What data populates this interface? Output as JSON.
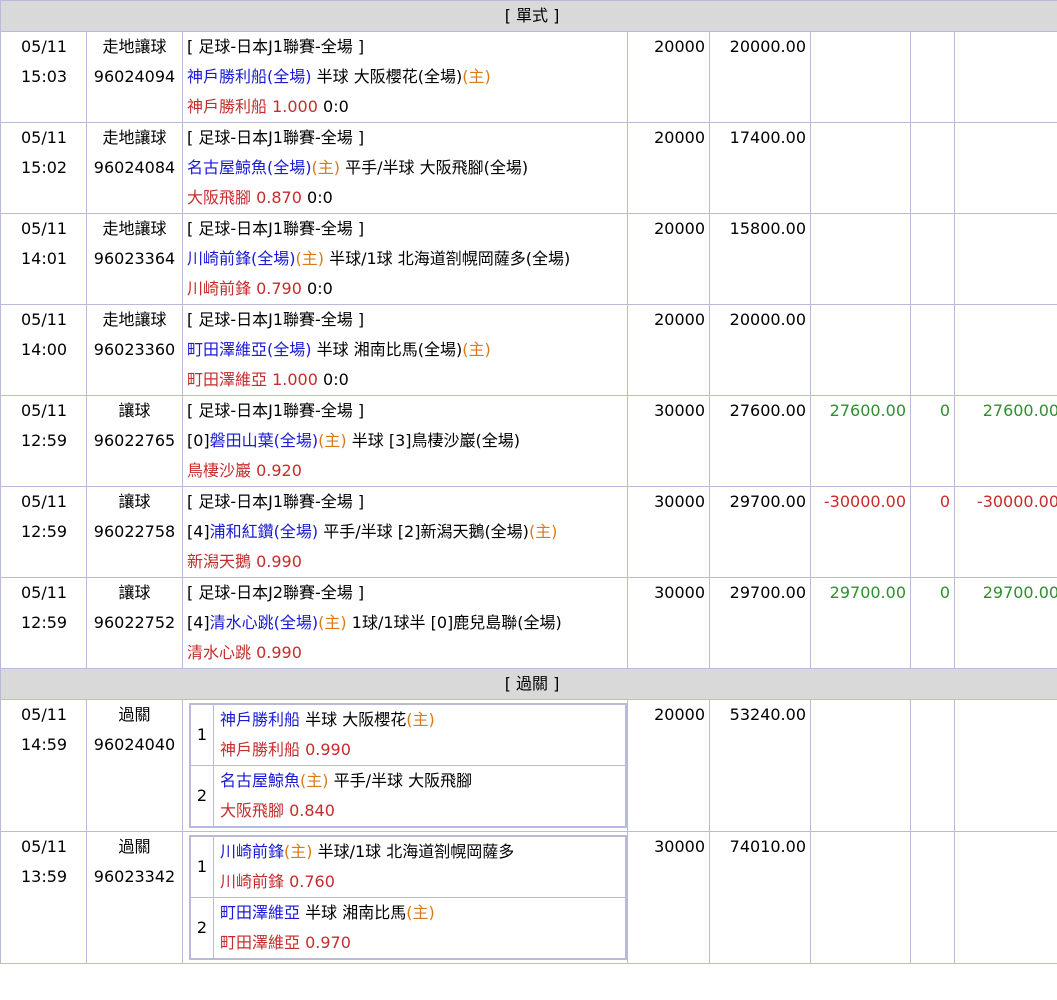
{
  "sections": {
    "single": "[ 單式 ]",
    "parlay": "[ 過關 ]"
  },
  "singles": [
    {
      "date": "05/11",
      "time": "15:03",
      "type": "走地讓球",
      "id": "96024094",
      "league": "[ 足球-日本J1聯賽-全場 ]",
      "home_prefix": "",
      "home": "神戶勝利船(全場)",
      "home_tag": "",
      "handicap": "半球",
      "away_prefix": "",
      "away": "大阪櫻花(全場)",
      "away_tag": "(主)",
      "pick": "神戶勝利船",
      "odds": "1.000",
      "score": "0:0",
      "stake": "20000",
      "payout": "20000.00",
      "result": "",
      "col2": "",
      "col3": ""
    },
    {
      "date": "05/11",
      "time": "15:02",
      "type": "走地讓球",
      "id": "96024084",
      "league": "[ 足球-日本J1聯賽-全場 ]",
      "home_prefix": "",
      "home": "名古屋鯨魚(全場)",
      "home_tag": "(主)",
      "handicap": "平手/半球",
      "away_prefix": "",
      "away": "大阪飛腳(全場)",
      "away_tag": "",
      "pick": "大阪飛腳",
      "odds": "0.870",
      "score": "0:0",
      "stake": "20000",
      "payout": "17400.00",
      "result": "",
      "col2": "",
      "col3": ""
    },
    {
      "date": "05/11",
      "time": "14:01",
      "type": "走地讓球",
      "id": "96023364",
      "league": "[ 足球-日本J1聯賽-全場 ]",
      "home_prefix": "",
      "home": "川崎前鋒(全場)",
      "home_tag": "(主)",
      "handicap": "半球/1球",
      "away_prefix": "",
      "away": "北海道劄幌岡薩多(全場)",
      "away_tag": "",
      "pick": "川崎前鋒",
      "odds": "0.790",
      "score": "0:0",
      "stake": "20000",
      "payout": "15800.00",
      "result": "",
      "col2": "",
      "col3": ""
    },
    {
      "date": "05/11",
      "time": "14:00",
      "type": "走地讓球",
      "id": "96023360",
      "league": "[ 足球-日本J1聯賽-全場 ]",
      "home_prefix": "",
      "home": "町田澤維亞(全場)",
      "home_tag": "",
      "handicap": "半球",
      "away_prefix": "",
      "away": "湘南比馬(全場)",
      "away_tag": "(主)",
      "pick": "町田澤維亞",
      "odds": "1.000",
      "score": "0:0",
      "stake": "20000",
      "payout": "20000.00",
      "result": "",
      "col2": "",
      "col3": ""
    },
    {
      "date": "05/11",
      "time": "12:59",
      "type": "讓球",
      "id": "96022765",
      "league": "[ 足球-日本J1聯賽-全場 ]",
      "home_prefix": "[0]",
      "home": "磐田山葉(全場)",
      "home_tag": "(主)",
      "handicap": "半球",
      "away_prefix": "[3]",
      "away": "鳥棲沙巖(全場)",
      "away_tag": "",
      "pick": "鳥棲沙巖",
      "odds": "0.920",
      "score": "",
      "stake": "30000",
      "payout": "27600.00",
      "result": "27600.00",
      "col2": "0",
      "col3": "27600.00",
      "sign": "pos"
    },
    {
      "date": "05/11",
      "time": "12:59",
      "type": "讓球",
      "id": "96022758",
      "league": "[ 足球-日本J1聯賽-全場 ]",
      "home_prefix": "[4]",
      "home": "浦和紅鑽(全場)",
      "home_tag": "",
      "handicap": "平手/半球",
      "away_prefix": "[2]",
      "away": "新潟天鵝(全場)",
      "away_tag": "(主)",
      "pick": "新潟天鵝",
      "odds": "0.990",
      "score": "",
      "stake": "30000",
      "payout": "29700.00",
      "result": "-30000.00",
      "col2": "0",
      "col3": "-30000.00",
      "sign": "neg"
    },
    {
      "date": "05/11",
      "time": "12:59",
      "type": "讓球",
      "id": "96022752",
      "league": "[ 足球-日本J2聯賽-全場 ]",
      "home_prefix": "[4]",
      "home": "清水心跳(全場)",
      "home_tag": "(主)",
      "handicap": "1球/1球半",
      "away_prefix": "[0]",
      "away": "鹿兒島聯(全場)",
      "away_tag": "",
      "pick": "清水心跳",
      "odds": "0.990",
      "score": "",
      "stake": "30000",
      "payout": "29700.00",
      "result": "29700.00",
      "col2": "0",
      "col3": "29700.00",
      "sign": "pos"
    }
  ],
  "parlays": [
    {
      "date": "05/11",
      "time": "14:59",
      "type": "過關",
      "id": "96024040",
      "stake": "20000",
      "payout": "53240.00",
      "legs": [
        {
          "no": "1",
          "home": "神戶勝利船",
          "home_tag": "",
          "handicap": "半球",
          "away": "大阪櫻花",
          "away_tag": "(主)",
          "pick": "神戶勝利船",
          "odds": "0.990"
        },
        {
          "no": "2",
          "home": "名古屋鯨魚",
          "home_tag": "(主)",
          "handicap": "平手/半球",
          "away": "大阪飛腳",
          "away_tag": "",
          "pick": "大阪飛腳",
          "odds": "0.840"
        }
      ]
    },
    {
      "date": "05/11",
      "time": "13:59",
      "type": "過關",
      "id": "96023342",
      "stake": "30000",
      "payout": "74010.00",
      "legs": [
        {
          "no": "1",
          "home": "川崎前鋒",
          "home_tag": "(主)",
          "handicap": "半球/1球",
          "away": "北海道劄幌岡薩多",
          "away_tag": "",
          "pick": "川崎前鋒",
          "odds": "0.760"
        },
        {
          "no": "2",
          "home": "町田澤維亞",
          "home_tag": "",
          "handicap": "半球",
          "away": "湘南比馬",
          "away_tag": "(主)",
          "pick": "町田澤維亞",
          "odds": "0.970"
        }
      ]
    }
  ],
  "colors": {
    "team": "#1a1ad6",
    "home_tag": "#d97a1a",
    "pick": "#c62c2c",
    "win": "#2f8f2f",
    "loss": "#c62c2c"
  }
}
